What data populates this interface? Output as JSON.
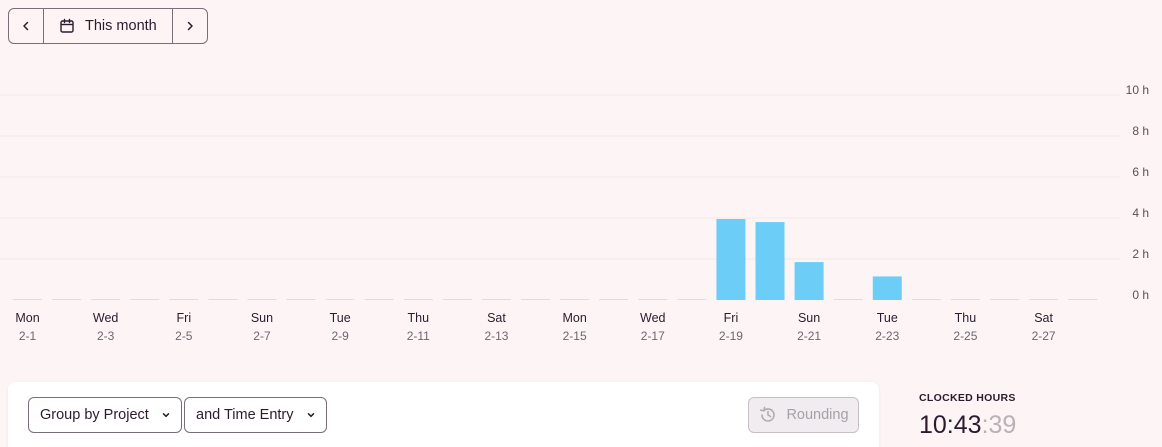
{
  "range_nav": {
    "label": "This month",
    "prev_icon": "chevron-left-icon",
    "next_icon": "chevron-right-icon",
    "calendar_icon": "calendar-icon"
  },
  "chart_data": {
    "type": "bar",
    "y_ticks": [
      "0 h",
      "2 h",
      "4 h",
      "6 h",
      "8 h",
      "10 h"
    ],
    "ylim": [
      0,
      10
    ],
    "grid": true,
    "bar_color": "#6ccdf7",
    "categories": [
      "2-1",
      "2-2",
      "2-3",
      "2-4",
      "2-5",
      "2-6",
      "2-7",
      "2-8",
      "2-9",
      "2-10",
      "2-11",
      "2-12",
      "2-13",
      "2-14",
      "2-15",
      "2-16",
      "2-17",
      "2-18",
      "2-19",
      "2-20",
      "2-21",
      "2-22",
      "2-23",
      "2-24",
      "2-25",
      "2-26",
      "2-27",
      "2-28"
    ],
    "values": [
      0,
      0,
      0,
      0,
      0,
      0,
      0,
      0,
      0,
      0,
      0,
      0,
      0,
      0,
      0,
      0,
      0,
      0,
      3.95,
      3.8,
      1.85,
      0,
      1.15,
      0,
      0,
      0,
      0,
      0
    ],
    "x_labels": [
      {
        "day": "Mon",
        "date": "2-1"
      },
      {
        "day": "Wed",
        "date": "2-3"
      },
      {
        "day": "Fri",
        "date": "2-5"
      },
      {
        "day": "Sun",
        "date": "2-7"
      },
      {
        "day": "Tue",
        "date": "2-9"
      },
      {
        "day": "Thu",
        "date": "2-11"
      },
      {
        "day": "Sat",
        "date": "2-13"
      },
      {
        "day": "Mon",
        "date": "2-15"
      },
      {
        "day": "Wed",
        "date": "2-17"
      },
      {
        "day": "Fri",
        "date": "2-19"
      },
      {
        "day": "Sun",
        "date": "2-21"
      },
      {
        "day": "Tue",
        "date": "2-23"
      },
      {
        "day": "Thu",
        "date": "2-25"
      },
      {
        "day": "Sat",
        "date": "2-27"
      }
    ]
  },
  "toolbar": {
    "group_by_label": "Group by Project",
    "subgroup_label": "and Time Entry",
    "rounding_label": "Rounding",
    "rounding_icon": "history-icon"
  },
  "clocked": {
    "label": "CLOCKED HOURS",
    "hours_minutes": "10:43",
    "seconds": ":39"
  }
}
